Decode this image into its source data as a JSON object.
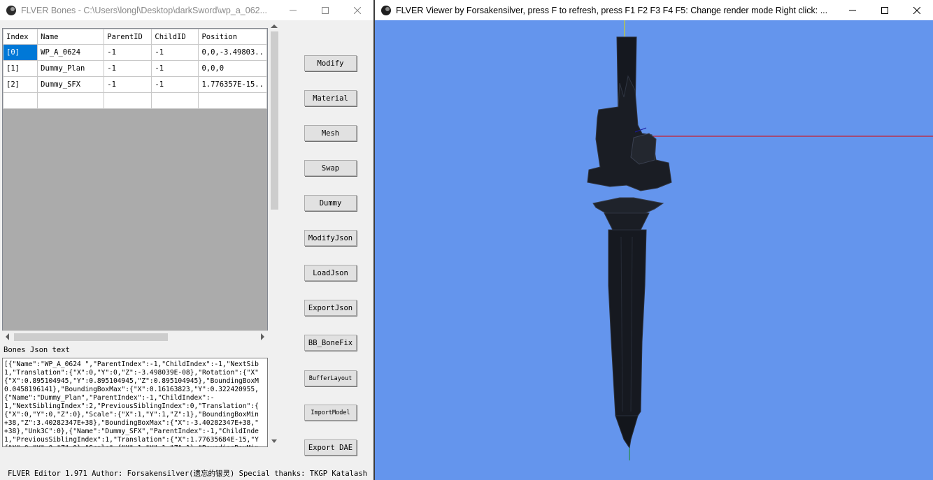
{
  "left_window": {
    "title": "FLVER Bones - C:\\Users\\longl\\Desktop\\darkSword\\wp_a_062...",
    "grid": {
      "columns": [
        "Index",
        "Name",
        "ParentID",
        "ChildID",
        "Position"
      ],
      "rows": [
        [
          "[0]",
          "WP_A_0624",
          "-1",
          "-1",
          "0,0,-3.49803.."
        ],
        [
          "[1]",
          "Dummy_Plan",
          "-1",
          "-1",
          "0,0,0"
        ],
        [
          "[2]",
          "Dummy_SFX",
          "-1",
          "-1",
          "1.776357E-15.."
        ],
        [
          "",
          "",
          "",
          "",
          ""
        ]
      ]
    },
    "json_label": "Bones Json text",
    "json_text": "[{\"Name\":\"WP_A_0624 \",\"ParentIndex\":-1,\"ChildIndex\":-1,\"NextSib\n1,\"Translation\":{\"X\":0,\"Y\":0,\"Z\":-3.498039E-08},\"Rotation\":{\"X\"\n{\"X\":0.895104945,\"Y\":0.895104945,\"Z\":0.895104945},\"BoundingBoxM\n0.0458196141},\"BoundingBoxMax\":{\"X\":0.16163823,\"Y\":0.322420955,\n{\"Name\":\"Dummy_Plan\",\"ParentIndex\":-1,\"ChildIndex\":-\n1,\"NextSiblingIndex\":2,\"PreviousSiblingIndex\":0,\"Translation\":{\n{\"X\":0,\"Y\":0,\"Z\":0},\"Scale\":{\"X\":1,\"Y\":1,\"Z\":1},\"BoundingBoxMin\n+38,\"Z\":3.40282347E+38},\"BoundingBoxMax\":{\"X\":-3.40282347E+38,\"\n+38},\"Unk3C\":0},{\"Name\":\"Dummy_SFX\",\"ParentIndex\":-1,\"ChildInde\n1,\"PreviousSiblingIndex\":1,\"Translation\":{\"X\":1.77635684E-15,\"Y\n{\"X\":0,\"Y\":0,\"Z\":0},\"Scale\":{\"X\":1,\"Y\":1,\"Z\":1},\"BoundingBoxMin",
    "buttons": {
      "modify": "Modify",
      "material": "Material",
      "mesh": "Mesh",
      "swap": "Swap",
      "dummy": "Dummy",
      "modify_json": "ModifyJson",
      "load_json": "LoadJson",
      "export_json": "ExportJson",
      "bb_bonefix": "BB_BoneFix",
      "buffer_layout": "BufferLayout",
      "import_model": "ImportModel",
      "export_dae": "Export DAE"
    },
    "footer": "FLVER Editor 1.971 Author: Forsakensilver(遗忘的银灵) Special thanks: TKGP  Katalash"
  },
  "right_window": {
    "title": "FLVER Viewer by Forsakensilver, press F to refresh, press F1 F2 F3 F4 F5: Change render mode Right click: ...",
    "viewport_bg": "#6495ed"
  },
  "icons": {
    "app": "app-icon",
    "minimize": "minimize-icon",
    "maximize": "maximize-icon",
    "close": "close-icon"
  }
}
